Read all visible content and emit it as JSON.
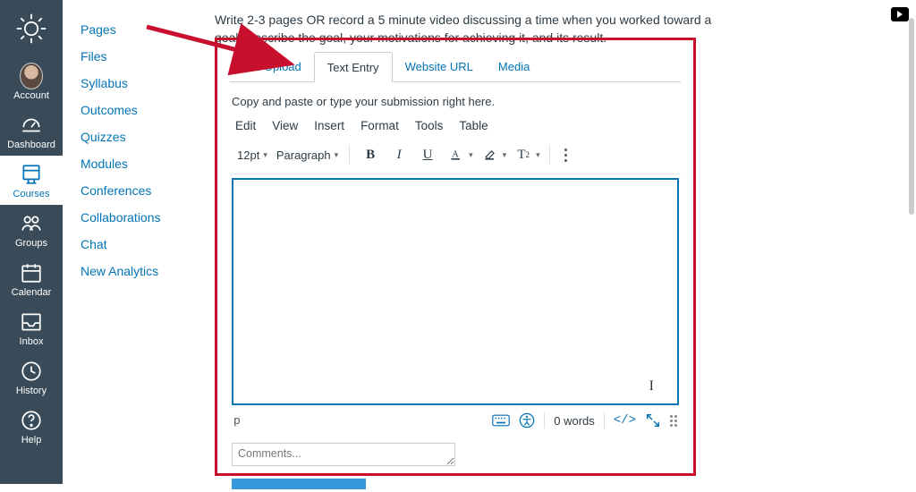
{
  "global_nav": {
    "items": [
      {
        "label": "Account"
      },
      {
        "label": "Dashboard"
      },
      {
        "label": "Courses"
      },
      {
        "label": "Groups"
      },
      {
        "label": "Calendar"
      },
      {
        "label": "Inbox"
      },
      {
        "label": "History"
      },
      {
        "label": "Help"
      }
    ]
  },
  "course_nav": {
    "items": [
      "Pages",
      "Files",
      "Syllabus",
      "Outcomes",
      "Quizzes",
      "Modules",
      "Conferences",
      "Collaborations",
      "Chat",
      "New Analytics"
    ]
  },
  "instructions": "Write 2-3 pages OR record a 5 minute video discussing a time when you worked toward a goal. Describe the goal, your motivations for achieving it, and its result.",
  "tabs": {
    "items": [
      "File Upload",
      "Text Entry",
      "Website URL",
      "Media"
    ],
    "active_index": 1
  },
  "subhint": "Copy and paste or type your submission right here.",
  "editor": {
    "menubar": [
      "Edit",
      "View",
      "Insert",
      "Format",
      "Tools",
      "Table"
    ],
    "font_size": "12pt",
    "block_format": "Paragraph",
    "path": "p",
    "word_count": "0 words",
    "html_label": "</>"
  },
  "comments_placeholder": "Comments..."
}
